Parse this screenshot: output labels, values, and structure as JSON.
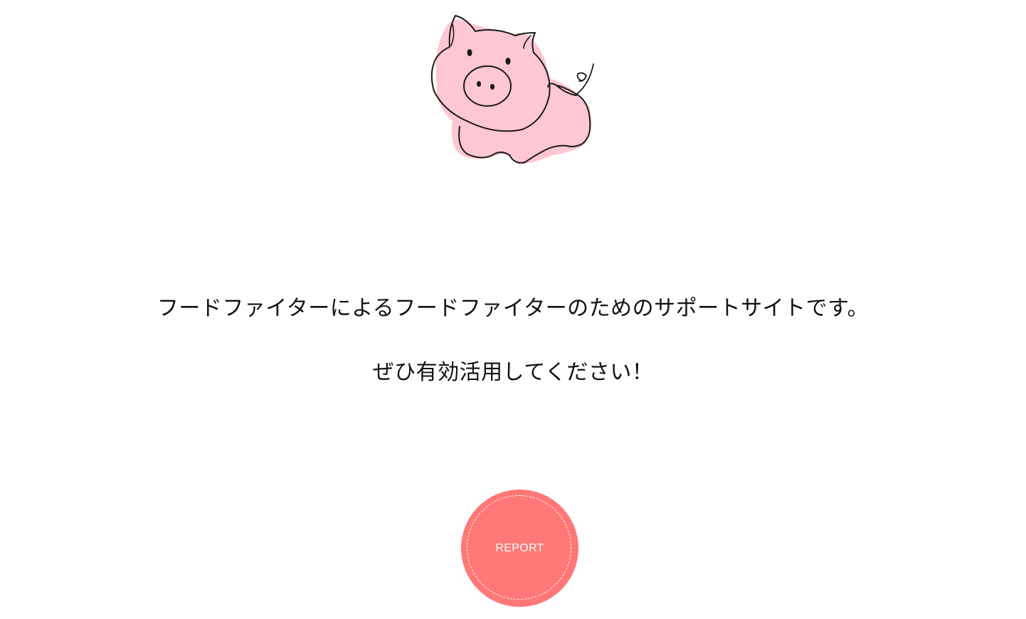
{
  "hero": {
    "illustration": "pig-icon"
  },
  "message": {
    "line1": "フードファイターによるフードファイターのためのサポートサイトです。",
    "line2": "ぜひ有効活用してください！"
  },
  "report_button": {
    "label": "REPORT"
  },
  "colors": {
    "background": "#ffffff",
    "pig_fill": "#ffc6d3",
    "button": "#ff7877",
    "text": "#111111"
  }
}
